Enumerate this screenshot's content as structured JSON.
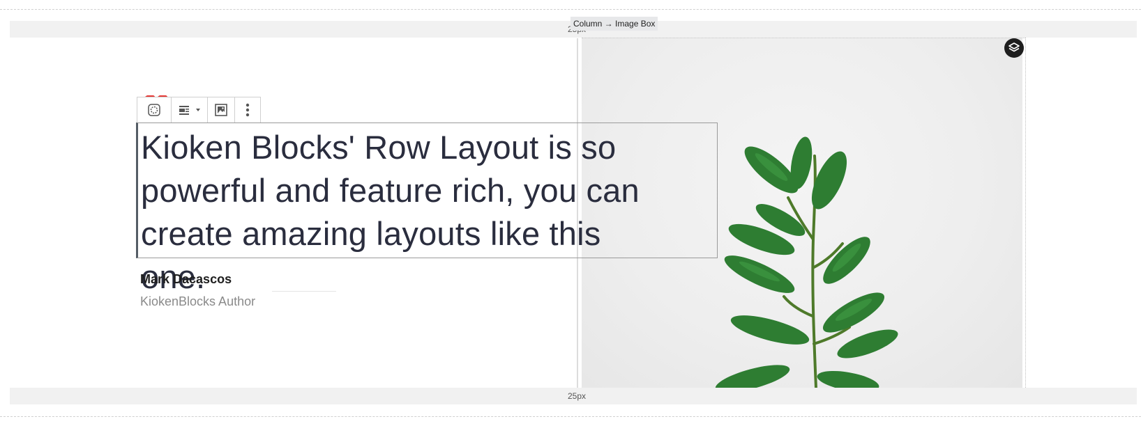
{
  "spacers": {
    "top_label": "25px",
    "bottom_label": "25px"
  },
  "breadcrumb": {
    "text": "Column → Image Box"
  },
  "toolbar": {
    "items": [
      "block-type",
      "align-dropdown",
      "image",
      "more-options"
    ]
  },
  "quote": {
    "text": "Kioken Blocks' Row Layout is so powerful and feature rich, you can create amazing layouts like this one."
  },
  "author": {
    "name": "Mark Dacascos",
    "role": "KiokenBlocks Author"
  },
  "colors": {
    "heading": "#2a2d3e",
    "accent": "#e53935",
    "leaf": "#2e7d32",
    "layers_button": "#1e1e1e"
  }
}
